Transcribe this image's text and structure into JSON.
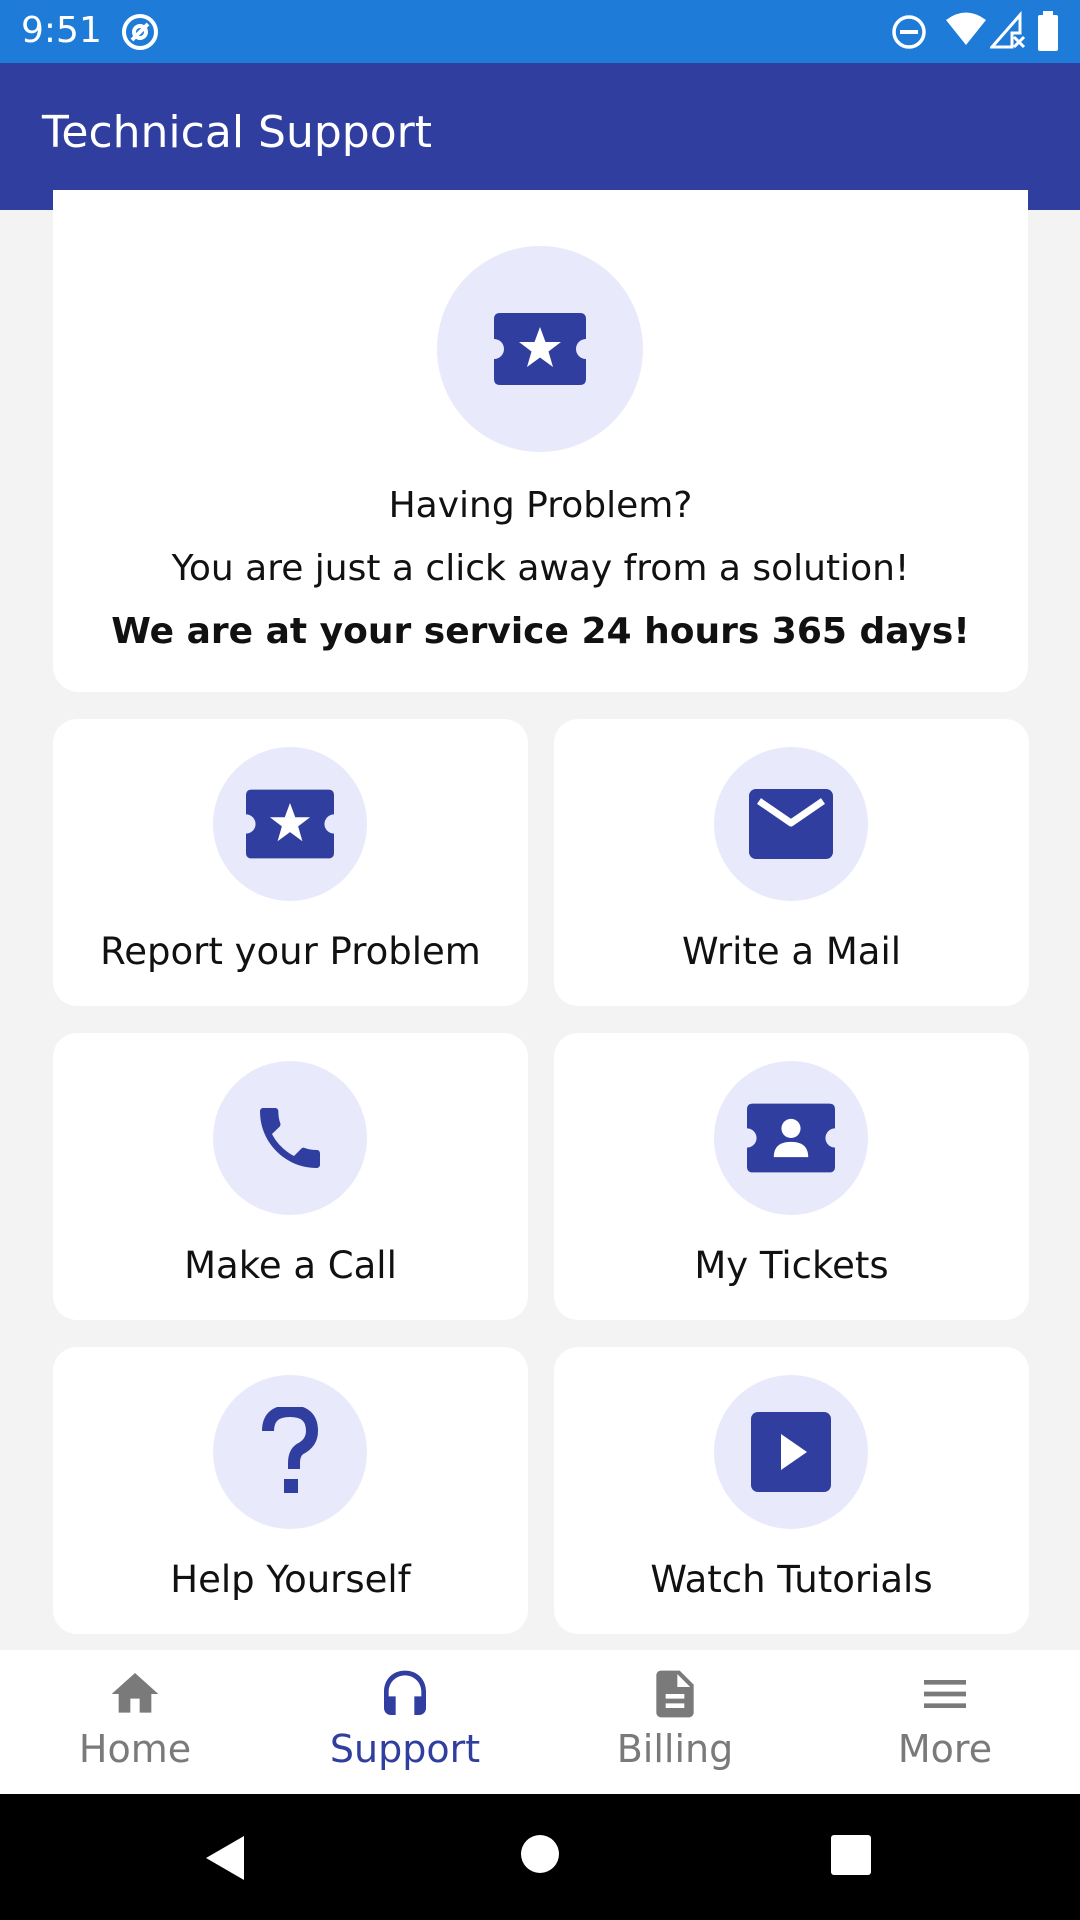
{
  "status_bar": {
    "time": "9:51",
    "icons": [
      "at-sign-icon",
      "do-not-disturb-icon",
      "wifi-icon",
      "cell-signal-icon",
      "battery-icon"
    ]
  },
  "app_bar": {
    "title": "Technical Support"
  },
  "hero": {
    "icon": "ticket-star-icon",
    "line1": "Having Problem?",
    "line2": "You are just a click away from a solution!",
    "line3": "We are at your service 24 hours 365 days!"
  },
  "tiles": [
    {
      "label": "Report your Problem",
      "icon": "ticket-star-icon"
    },
    {
      "label": "Write a Mail",
      "icon": "mail-icon"
    },
    {
      "label": "Make a Call",
      "icon": "phone-icon"
    },
    {
      "label": "My Tickets",
      "icon": "ticket-user-icon"
    },
    {
      "label": "Help Yourself",
      "icon": "question-icon"
    },
    {
      "label": "Watch Tutorials",
      "icon": "play-icon"
    }
  ],
  "bottom_nav": {
    "items": [
      {
        "label": "Home",
        "icon": "home-icon",
        "active": false
      },
      {
        "label": "Support",
        "icon": "headphones-icon",
        "active": true
      },
      {
        "label": "Billing",
        "icon": "document-icon",
        "active": false
      },
      {
        "label": "More",
        "icon": "menu-icon",
        "active": false
      }
    ]
  },
  "colors": {
    "status_bar": "#1e7bd8",
    "app_bar": "#303f9f",
    "accent": "#303f9f",
    "icon_circle": "#e8eafb",
    "inactive": "#7a7a7a"
  }
}
